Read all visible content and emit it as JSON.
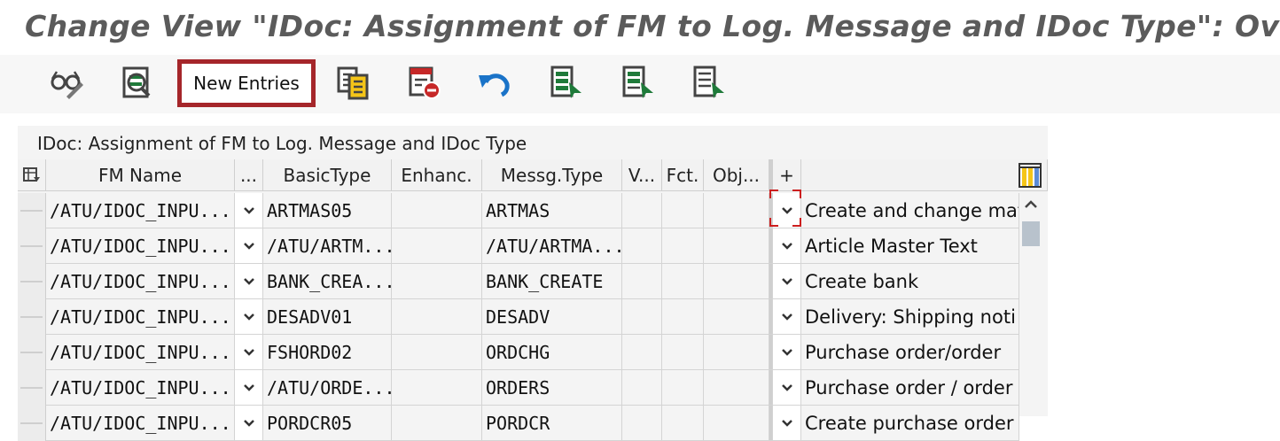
{
  "window": {
    "title": "Change View \"IDoc: Assignment of FM to Log. Message and IDoc Type\": Ov"
  },
  "toolbar": {
    "new_entries_label": "New Entries",
    "icons": [
      "display-change-icon",
      "details-icon",
      "new-entries-button",
      "copy-icon",
      "delete-icon",
      "undo-icon",
      "select-all-icon",
      "select-block-icon",
      "deselect-all-icon"
    ]
  },
  "table": {
    "title": "IDoc: Assignment of FM to Log. Message and IDoc Type",
    "columns": {
      "fm_name": "FM Name",
      "ellipsis": "...",
      "basic_type": "BasicType",
      "enhancement": "Enhanc.",
      "message_type": "Messg.Type",
      "variant": "V...",
      "function": "Fct.",
      "object": "Obj...",
      "plus": "+"
    },
    "rows": [
      {
        "fm_name": "/ATU/IDOC_INPU...",
        "basic_type": "ARTMAS05",
        "enhancement": "",
        "message_type": "ARTMAS",
        "variant": "",
        "function": "",
        "object": "",
        "description": "Create and change mat"
      },
      {
        "fm_name": "/ATU/IDOC_INPU...",
        "basic_type": "/ATU/ARTM...",
        "enhancement": "",
        "message_type": "/ATU/ARTMA...",
        "variant": "",
        "function": "",
        "object": "",
        "description": "Article Master Text"
      },
      {
        "fm_name": "/ATU/IDOC_INPU...",
        "basic_type": "BANK_CREA...",
        "enhancement": "",
        "message_type": "BANK_CREATE",
        "variant": "",
        "function": "",
        "object": "",
        "description": "Create bank"
      },
      {
        "fm_name": "/ATU/IDOC_INPU...",
        "basic_type": "DESADV01",
        "enhancement": "",
        "message_type": "DESADV",
        "variant": "",
        "function": "",
        "object": "",
        "description": "Delivery: Shipping noti"
      },
      {
        "fm_name": "/ATU/IDOC_INPU...",
        "basic_type": "FSHORD02",
        "enhancement": "",
        "message_type": "ORDCHG",
        "variant": "",
        "function": "",
        "object": "",
        "description": "Purchase order/order"
      },
      {
        "fm_name": "/ATU/IDOC_INPU...",
        "basic_type": "/ATU/ORDE...",
        "enhancement": "",
        "message_type": "ORDERS",
        "variant": "",
        "function": "",
        "object": "",
        "description": "Purchase order / order"
      },
      {
        "fm_name": "/ATU/IDOC_INPU...",
        "basic_type": "PORDCR05",
        "enhancement": "",
        "message_type": "PORDCR",
        "variant": "",
        "function": "",
        "object": "",
        "description": "Create purchase order"
      }
    ]
  },
  "colors": {
    "highlight_border": "#a5262a",
    "focus_corner": "#cc1f1f",
    "undo_blue": "#1a73c8",
    "nav_green": "#1f7a3a"
  }
}
